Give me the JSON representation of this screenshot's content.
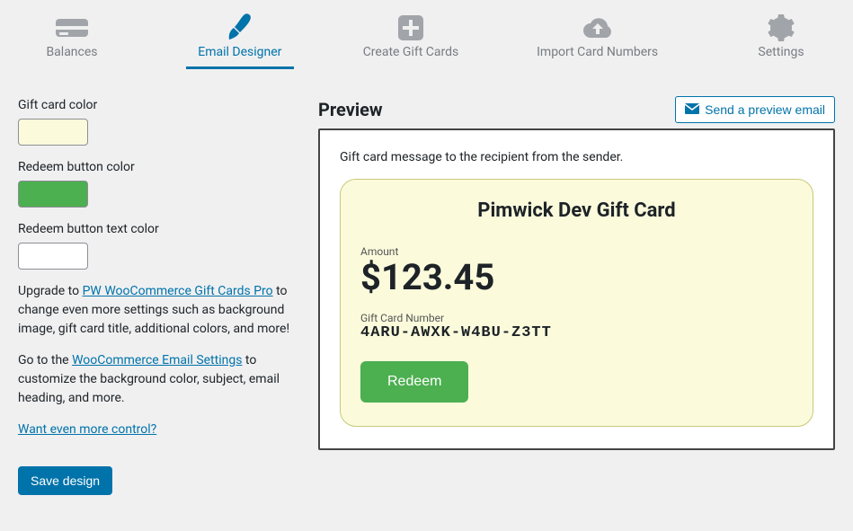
{
  "tabs": {
    "balances": "Balances",
    "email_designer": "Email Designer",
    "create": "Create Gift Cards",
    "import": "Import Card Numbers",
    "settings": "Settings"
  },
  "left": {
    "gift_card_color_label": "Gift card color",
    "gift_card_color": "#fbfbdc",
    "redeem_btn_color_label": "Redeem button color",
    "redeem_btn_color": "#4caf50",
    "redeem_btn_text_color_label": "Redeem button text color",
    "redeem_btn_text_color": "#ffffff",
    "upgrade_pre": "Upgrade to ",
    "upgrade_link": "PW WooCommerce Gift Cards Pro",
    "upgrade_post": " to change even more settings such as background image, gift card title, additional colors, and more!",
    "goto_pre": "Go to the ",
    "goto_link": "WooCommerce Email Settings",
    "goto_post": " to customize the background color, subject, email heading, and more.",
    "more_control": "Want even more control?",
    "save": "Save design"
  },
  "preview": {
    "heading": "Preview",
    "send_btn": "Send a preview email",
    "message": "Gift card message to the recipient from the sender.",
    "card_title": "Pimwick Dev Gift Card",
    "amount_label": "Amount",
    "amount_value": "$123.45",
    "number_label": "Gift Card Number",
    "number_value": "4ARU-AWXK-W4BU-Z3TT",
    "redeem_label": "Redeem"
  }
}
